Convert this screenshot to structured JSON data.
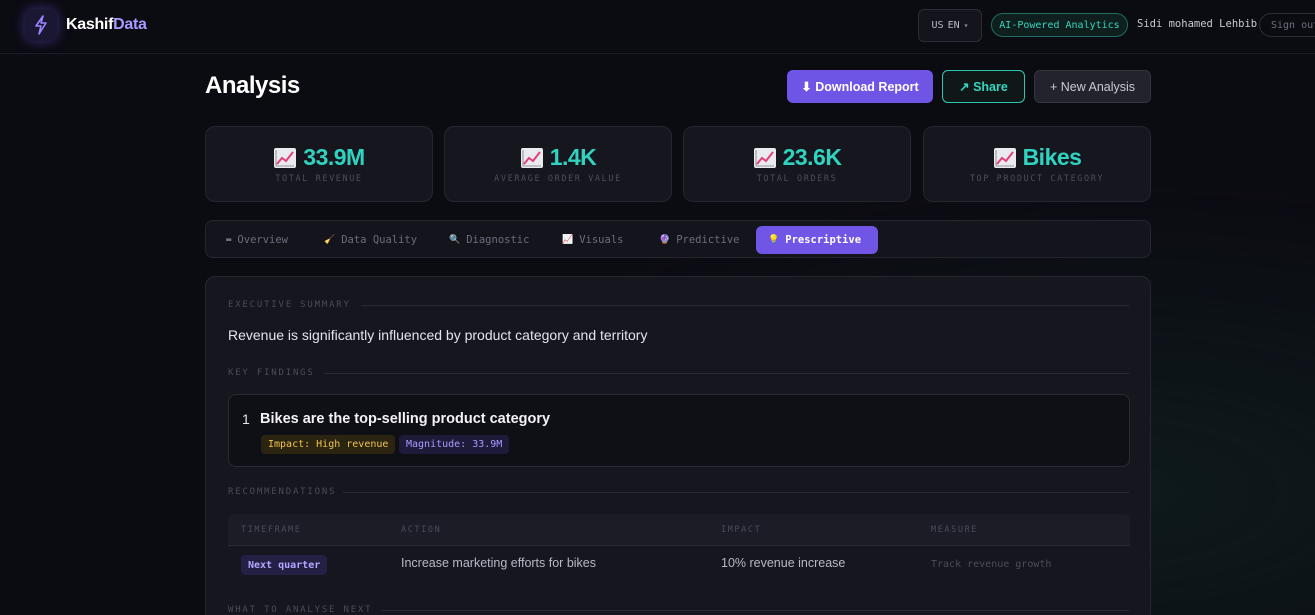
{
  "app": {
    "brand_part1": "Kashif",
    "brand_part2": "Data",
    "lang_flag": "US",
    "lang_code": "EN",
    "ai_badge": "AI-Powered Analytics",
    "user_name": "Sidi mohamed Lehbib",
    "sign_out": "Sign out"
  },
  "header": {
    "title": "Analysis",
    "download_label": "⬇ Download Report",
    "share_label": "↗ Share",
    "new_label": "+ New Analysis"
  },
  "kpis": [
    {
      "value": "33.9M",
      "label": "TOTAL REVENUE"
    },
    {
      "value": "1.4K",
      "label": "AVERAGE ORDER VALUE"
    },
    {
      "value": "23.6K",
      "label": "TOTAL ORDERS"
    },
    {
      "value": "Bikes",
      "label": "TOP PRODUCT CATEGORY"
    }
  ],
  "tabs": [
    {
      "icon": "▬",
      "label": "Overview"
    },
    {
      "icon": "🧹",
      "label": "Data Quality"
    },
    {
      "icon": "🔍",
      "label": "Diagnostic"
    },
    {
      "icon": "📈",
      "label": "Visuals"
    },
    {
      "icon": "🔮",
      "label": "Predictive"
    },
    {
      "icon": "💡",
      "label": "Prescriptive"
    }
  ],
  "summary": {
    "label": "EXECUTIVE SUMMARY",
    "text": "Revenue is significantly influenced by product category and territory"
  },
  "findings": {
    "label": "KEY FINDINGS",
    "items": [
      {
        "num": "1",
        "title": "Bikes are the top-selling product category",
        "impact": "Impact: High revenue",
        "magnitude": "Magnitude: 33.9M"
      }
    ]
  },
  "recommendations": {
    "label": "RECOMMENDATIONS",
    "headers": [
      "TIMEFRAME",
      "ACTION",
      "IMPACT",
      "MEASURE"
    ],
    "rows": [
      {
        "timeframe": "Next quarter",
        "action": "Increase marketing efforts for bikes",
        "impact": "10% revenue increase",
        "measure": "Track revenue growth"
      }
    ]
  },
  "next": {
    "label": "WHAT TO ANALYSE NEXT"
  },
  "colors": {
    "accent": "#6f55e6",
    "teal": "#2fd3bf",
    "background": "#0b0b12"
  }
}
